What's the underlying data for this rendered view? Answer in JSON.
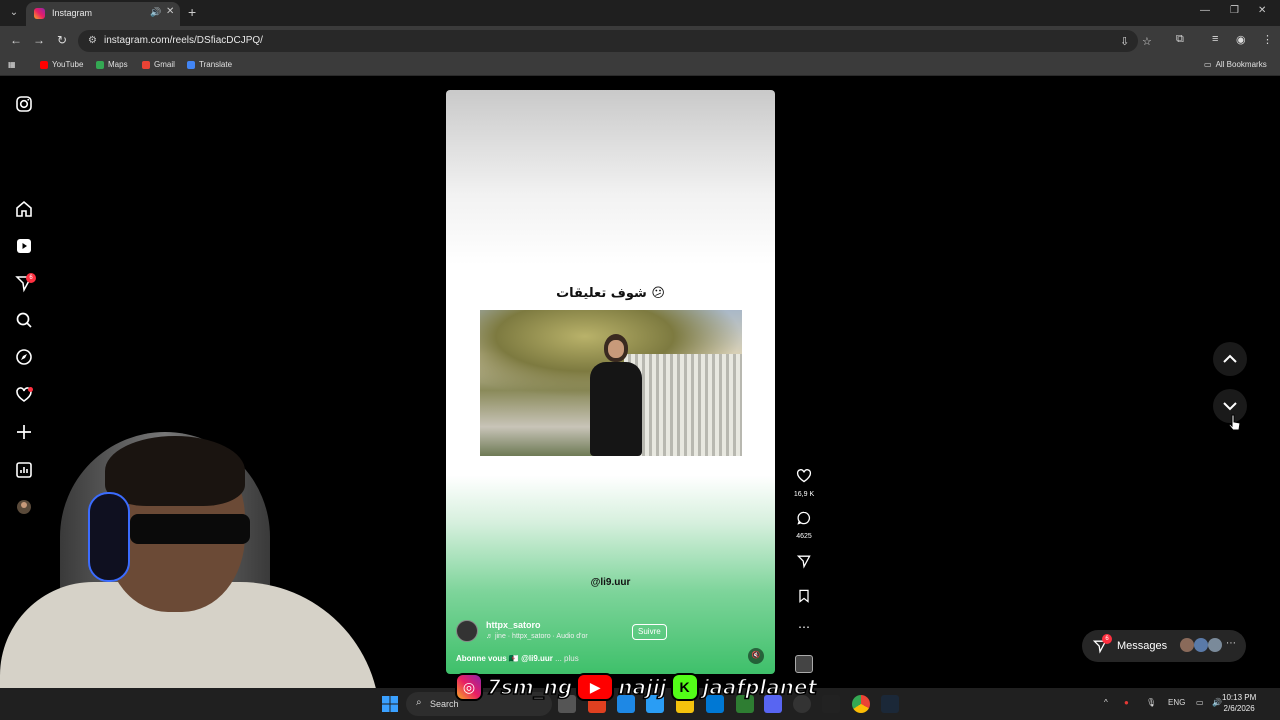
{
  "browser": {
    "tab_title": "Instagram",
    "url": "instagram.com/reels/DSfiacDCJPQ/",
    "bookmarks": [
      "YouTube",
      "Maps",
      "Gmail",
      "Translate"
    ],
    "all_bookmarks": "All Bookmarks"
  },
  "sidebar": {
    "notifications_badge": "6"
  },
  "reel": {
    "caption": "شوف تعليقات 😕",
    "handle_overlay": "@li9.uur",
    "author": "httpx_satoro",
    "audio": "♬ jine · httpx_satoro · Audio d'or",
    "follow": "Suivre",
    "description_prefix": "Abonne vous",
    "description_middle": "🇩🇿 @li9.uur",
    "description_more": "... plus"
  },
  "actions": {
    "likes": "16,9 K",
    "comments": "4625"
  },
  "messages": {
    "label": "Messages",
    "badge": "6"
  },
  "overlay": {
    "handle1": "7sm_ng",
    "handle2": "najij",
    "handle3": "jaafplanet"
  },
  "taskbar": {
    "search": "Search",
    "lang": "ENG",
    "time": "10:13 PM",
    "date": "2/6/2026"
  },
  "colors": {
    "accent_green": "#3ec06a",
    "badge_red": "#ff3040"
  }
}
